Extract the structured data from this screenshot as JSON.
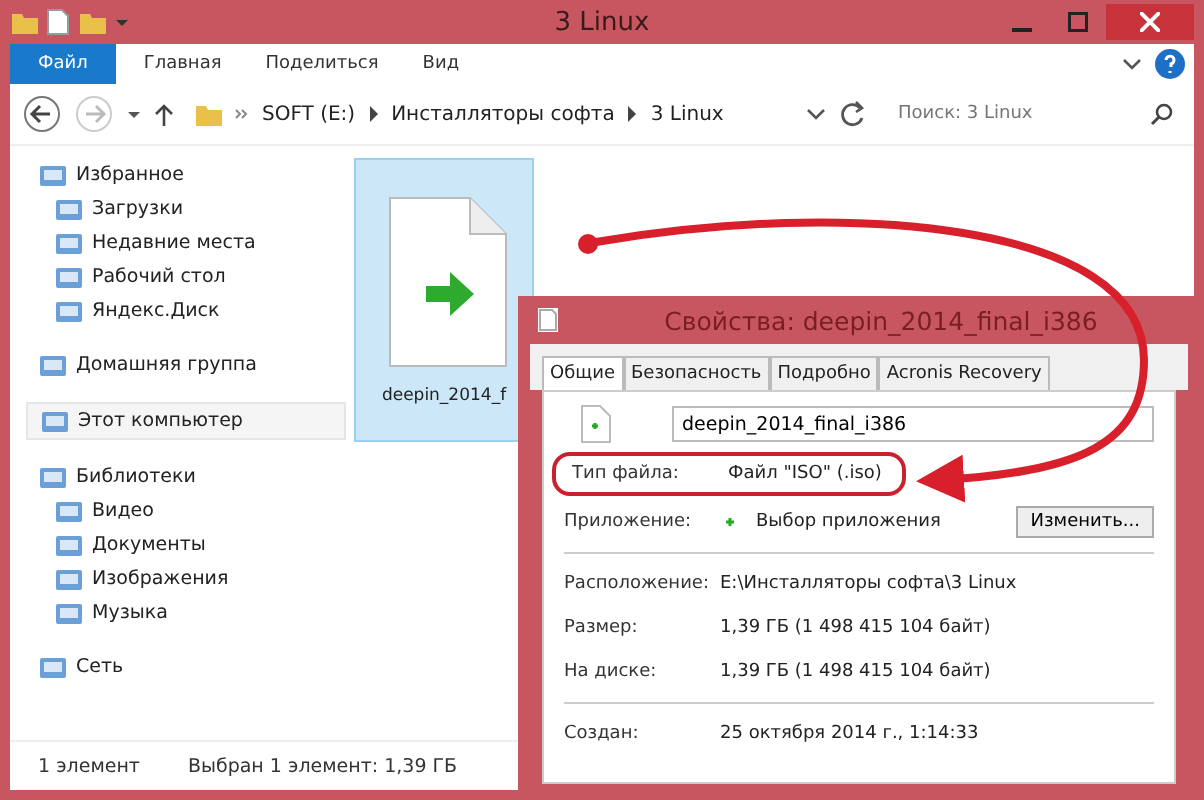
{
  "window": {
    "title": "3 Linux"
  },
  "ribbon_tabs": [
    {
      "label": "Файл",
      "selected": true
    },
    {
      "label": "Главная",
      "selected": false
    },
    {
      "label": "Поделиться",
      "selected": false
    },
    {
      "label": "Вид",
      "selected": false
    }
  ],
  "address_bar": {
    "path": [
      "SOFT (E:)",
      "Инсталляторы софта",
      "3 Linux"
    ],
    "search": {
      "placeholder": "Поиск: 3 Linux"
    }
  },
  "sidebar": {
    "items": [
      {
        "label": "Избранное",
        "selected": false,
        "children": [
          {
            "label": "Загрузки",
            "selected": false
          },
          {
            "label": "Недавние места",
            "selected": false
          },
          {
            "label": "Рабочий стол",
            "selected": false
          },
          {
            "label": "Яндекс.Диск",
            "selected": false
          }
        ]
      },
      {
        "label": "Домашняя группа",
        "selected": false
      },
      {
        "label": "Этот компьютер",
        "selected": true
      },
      {
        "label": "Библиотеки",
        "selected": false,
        "children": [
          {
            "label": "Видео",
            "selected": false
          },
          {
            "label": "Документы",
            "selected": false
          },
          {
            "label": "Изображения",
            "selected": false
          },
          {
            "label": "Музыка",
            "selected": false
          }
        ]
      },
      {
        "label": "Сеть",
        "selected": false
      }
    ]
  },
  "files": [
    {
      "name": "deepin_2014_f",
      "selected": true
    }
  ],
  "status_bar": {
    "count": "1 элемент",
    "selection": "Выбран 1 элемент: 1,39 ГБ"
  },
  "dialog": {
    "title": "Свойства: deepin_2014_final_i386",
    "tabs": [
      {
        "label": "Общие",
        "selected": true
      },
      {
        "label": "Безопасность",
        "selected": false
      },
      {
        "label": "Подробно",
        "selected": false
      },
      {
        "label": "Acronis Recovery",
        "selected": false
      }
    ],
    "file_name": "deepin_2014_final_i386",
    "rows": [
      {
        "kind": "highlight",
        "label": "Тип файла:",
        "value": "Файл \"ISO\" (.iso)"
      },
      {
        "kind": "app",
        "label": "Приложение:",
        "value": "Выбор приложения",
        "button": "Изменить..."
      },
      {
        "kind": "divider"
      },
      {
        "kind": "plain",
        "label": "Расположение:",
        "value": "E:\\Инсталляторы софта\\3 Linux"
      },
      {
        "kind": "plain",
        "label": "Размер:",
        "value": "1,39 ГБ (1 498 415 104 байт)"
      },
      {
        "kind": "plain",
        "label": "На диске:",
        "value": "1,39 ГБ (1 498 415 104 байт)"
      },
      {
        "kind": "divider"
      },
      {
        "kind": "plain",
        "label": "Создан:",
        "value": "25 октября 2014 г., 1:14:33"
      }
    ]
  }
}
